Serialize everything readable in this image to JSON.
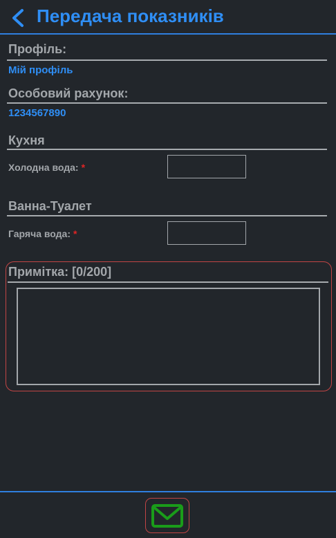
{
  "header": {
    "title": "Передача показників",
    "back_icon": "chevron-left-icon"
  },
  "profile": {
    "label": "Профіль:",
    "value": "Мій профіль"
  },
  "account": {
    "label": "Особовий рахунок:",
    "value": "1234567890"
  },
  "sections": [
    {
      "title": "Кухня",
      "field_label": "Холодна вода:",
      "required_mark": "*",
      "value": ""
    },
    {
      "title": "Ванна-Туалет",
      "field_label": "Гаряча вода:",
      "required_mark": "*",
      "value": ""
    }
  ],
  "note": {
    "label": "Примітка: [0/200]",
    "value": ""
  },
  "footer": {
    "send_icon": "envelope-icon"
  },
  "colors": {
    "background": "#22262b",
    "accent": "#2f8ef5",
    "label": "#a3a7ab",
    "required": "#e02424",
    "highlight_border": "#c24545",
    "send_icon": "#1a9c1a"
  }
}
